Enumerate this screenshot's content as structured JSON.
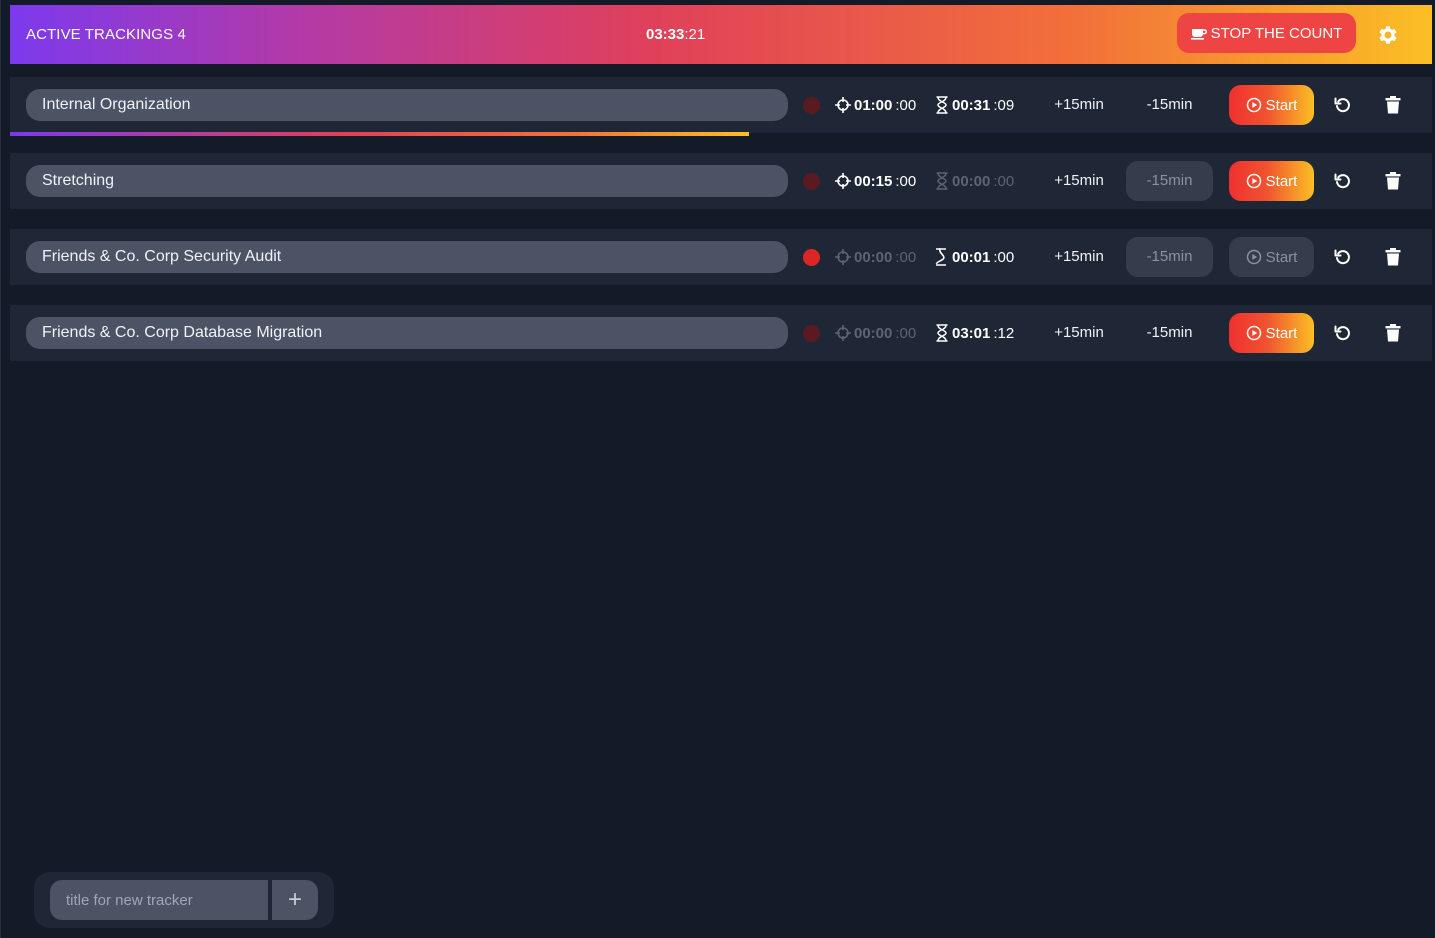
{
  "header": {
    "active_label": "ACTIVE TRACKINGS 4",
    "clock_main": "03:33",
    "clock_secs": ":21",
    "stop_label": "STOP THE COUNT"
  },
  "trackers": [
    {
      "title": "Internal Organization",
      "recording": false,
      "target_main": "01:00",
      "target_secs": " :00",
      "target_dim": false,
      "elapsed_main": "00:31",
      "elapsed_secs": " :09",
      "elapsed_dim": false,
      "plus_label": "+15min",
      "minus_label": "-15min",
      "minus_disabled": false,
      "start_label": "Start",
      "start_disabled": false,
      "progress": 0.52
    },
    {
      "title": "Stretching",
      "recording": false,
      "target_main": "00:15",
      "target_secs": " :00",
      "target_dim": false,
      "elapsed_main": "00:00",
      "elapsed_secs": " :00",
      "elapsed_dim": true,
      "plus_label": "+15min",
      "minus_label": "-15min",
      "minus_disabled": true,
      "start_label": "Start",
      "start_disabled": false
    },
    {
      "title": "Friends & Co. Corp Security Audit",
      "recording": true,
      "target_main": "00:00",
      "target_secs": " :00",
      "target_dim": true,
      "elapsed_main": "00:01",
      "elapsed_secs": " :00",
      "elapsed_dim": false,
      "plus_label": "+15min",
      "minus_label": "-15min",
      "minus_disabled": true,
      "start_label": "Start",
      "start_disabled": true
    },
    {
      "title": "Friends & Co. Corp Database Migration",
      "recording": false,
      "target_main": "00:00",
      "target_secs": " :00",
      "target_dim": true,
      "elapsed_main": "03:01",
      "elapsed_secs": " :12",
      "elapsed_dim": false,
      "plus_label": "+15min",
      "minus_label": "-15min",
      "minus_disabled": false,
      "start_label": "Start",
      "start_disabled": false
    }
  ],
  "new_tracker": {
    "placeholder": "title for new tracker",
    "add_label": "+"
  },
  "colors": {
    "background": "#131a28",
    "row": "#1f2736",
    "pill": "#4b5365",
    "accent_red": "#ef4444",
    "accent_yellow": "#fbbf24",
    "accent_purple": "#7c3aed"
  }
}
